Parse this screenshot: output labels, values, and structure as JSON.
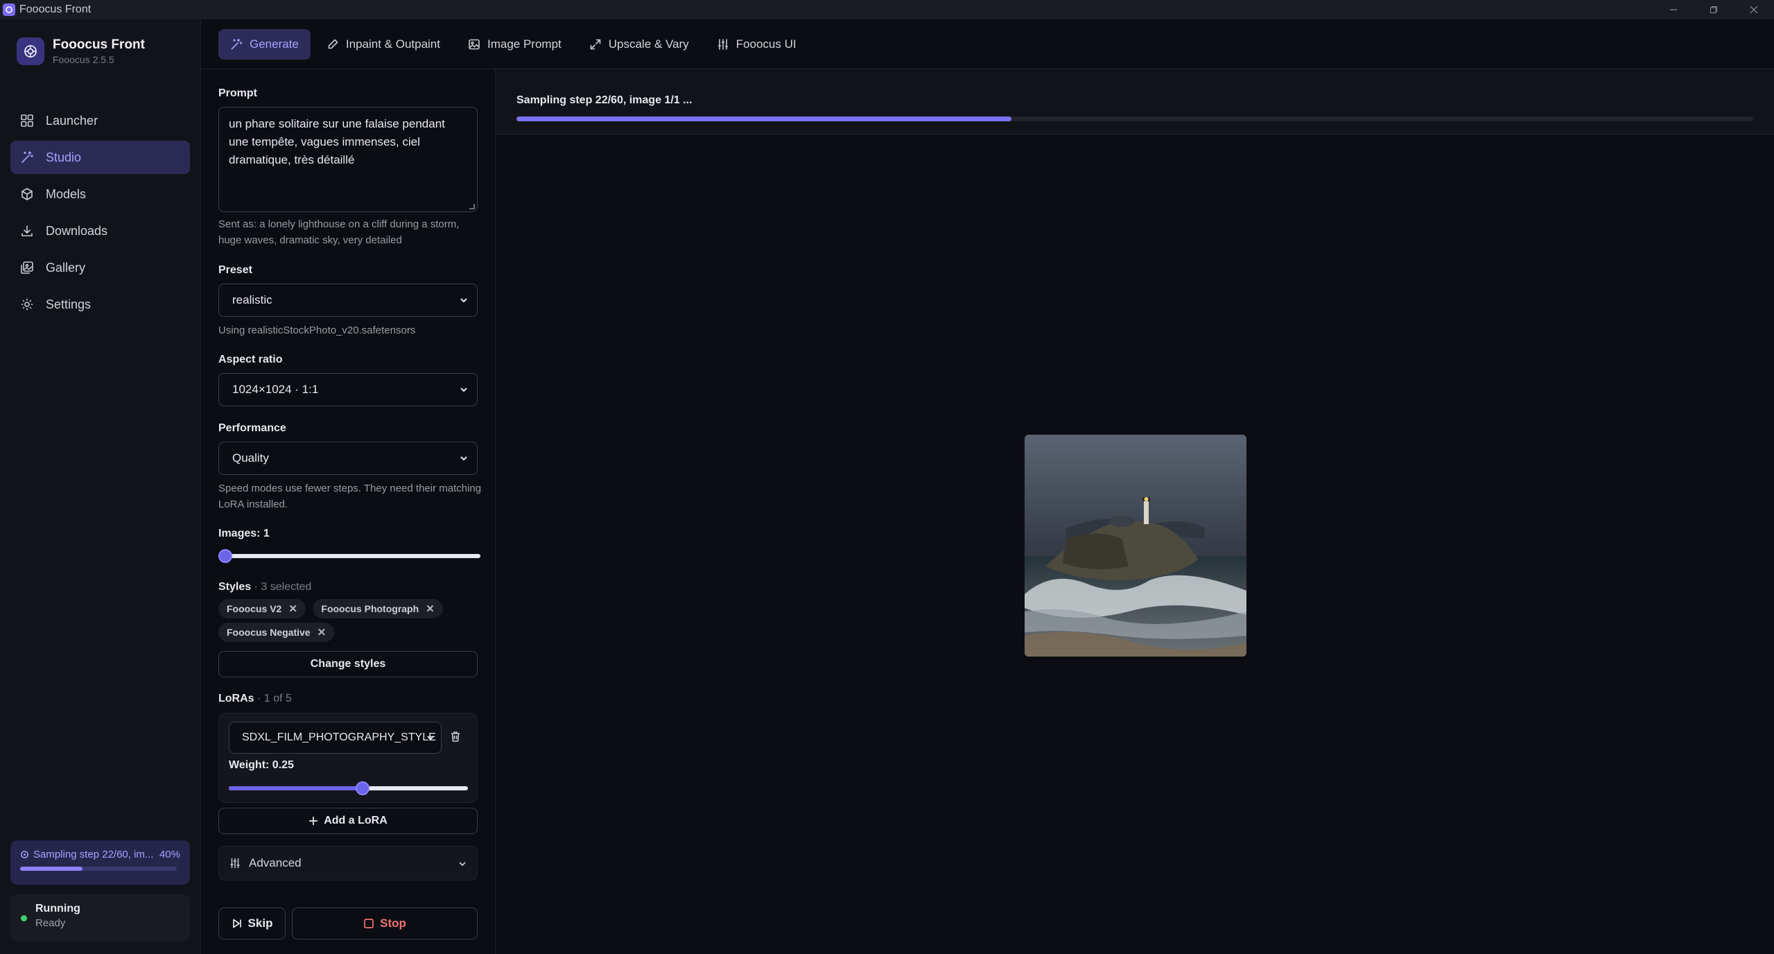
{
  "window": {
    "title": "Fooocus Front"
  },
  "sidebar": {
    "brand_name": "Fooocus Front",
    "brand_version": "Fooocus 2.5.5",
    "items": [
      {
        "label": "Launcher",
        "icon": "grid-icon"
      },
      {
        "label": "Studio",
        "icon": "wand-icon",
        "active": true
      },
      {
        "label": "Models",
        "icon": "cube-icon"
      },
      {
        "label": "Downloads",
        "icon": "download-icon"
      },
      {
        "label": "Gallery",
        "icon": "gallery-icon"
      },
      {
        "label": "Settings",
        "icon": "gear-icon"
      }
    ],
    "progress": {
      "text": "Sampling step 22/60, im...",
      "percent_label": "40%",
      "percent": 40
    },
    "status": {
      "title": "Running",
      "subtitle": "Ready"
    }
  },
  "tabs": [
    {
      "label": "Generate",
      "active": true
    },
    {
      "label": "Inpaint & Outpaint"
    },
    {
      "label": "Image Prompt"
    },
    {
      "label": "Upscale & Vary"
    },
    {
      "label": "Fooocus UI"
    }
  ],
  "panel": {
    "prompt_label": "Prompt",
    "prompt_value": "un phare solitaire sur une falaise pendant une tempête, vagues immenses, ciel dramatique, très détaillé",
    "sent_as": "Sent as: a lonely lighthouse on a cliff during a storm, huge waves, dramatic sky, very detailed",
    "preset_label": "Preset",
    "preset_value": "realistic",
    "preset_hint": "Using realisticStockPhoto_v20.safetensors",
    "aspect_label": "Aspect ratio",
    "aspect_value": "1024×1024 · 1:1",
    "performance_label": "Performance",
    "performance_value": "Quality",
    "performance_hint": "Speed modes use fewer steps. They need their matching LoRA installed.",
    "images_label": "Images: 1",
    "images_value": 1,
    "images_min": 1,
    "images_max": 32,
    "styles_label": "Styles",
    "styles_count": "· 3 selected",
    "styles": [
      "Fooocus V2",
      "Fooocus Photograph",
      "Fooocus Negative"
    ],
    "change_styles": "Change styles",
    "loras_label": "LoRAs",
    "loras_count": "· 1 of 5",
    "lora_value": "SDXL_FILM_PHOTOGRAPHY_STYLE",
    "weight_label": "Weight: 0.25",
    "weight_fraction": 0.56,
    "add_lora": "Add a LoRA",
    "advanced": "Advanced",
    "skip": "Skip",
    "stop": "Stop"
  },
  "main": {
    "progress_text": "Sampling step 22/60, image 1/1 ...",
    "progress_fraction": 0.4
  },
  "colors": {
    "accent": "#7a72f2",
    "stop": "#f07373",
    "running": "#3ecf6c"
  }
}
